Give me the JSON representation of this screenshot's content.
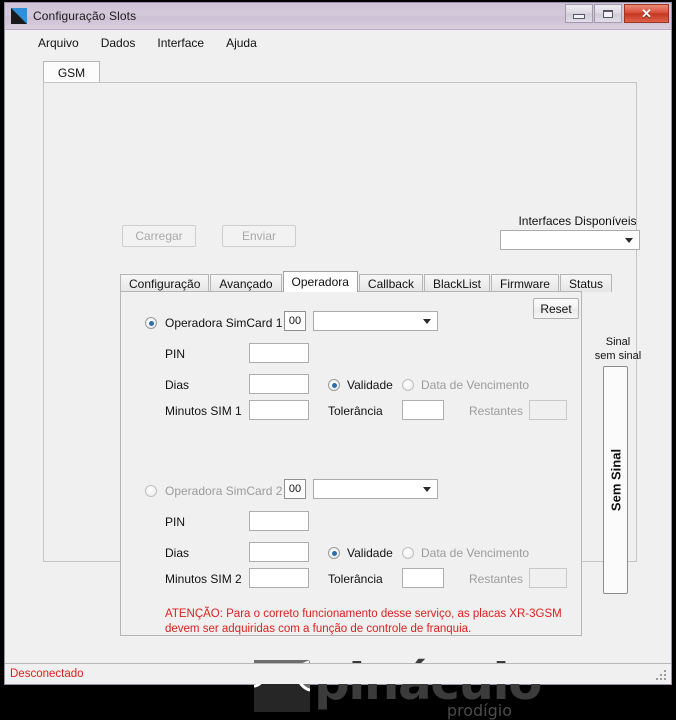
{
  "window": {
    "title": "Configuração Slots",
    "icon": "app-icon",
    "controls": {
      "minimize": "_",
      "maximize": "□",
      "close": "✕"
    }
  },
  "menu": {
    "items": [
      {
        "label": "Arquivo"
      },
      {
        "label": "Dados"
      },
      {
        "label": "Interface"
      },
      {
        "label": "Ajuda"
      }
    ]
  },
  "outer_tab": {
    "label": "GSM"
  },
  "toolbar": {
    "carregar_label": "Carregar",
    "enviar_label": "Enviar"
  },
  "interfaces": {
    "label": "Interfaces Disponíveis",
    "value": "",
    "placeholder": ""
  },
  "inner_tabs": [
    {
      "label": "Configuração",
      "active": false
    },
    {
      "label": "Avançado",
      "active": false
    },
    {
      "label": "Operadora",
      "active": true
    },
    {
      "label": "Callback",
      "active": false
    },
    {
      "label": "BlackList",
      "active": false
    },
    {
      "label": "Firmware",
      "active": false
    },
    {
      "label": "Status",
      "active": false
    }
  ],
  "reset_button": {
    "label": "Reset"
  },
  "simcard1": {
    "radio_label": "Operadora SimCard 1",
    "radio_selected": true,
    "code_value": "00",
    "operator_value": "",
    "pin_label": "PIN",
    "pin_value": "",
    "dias_label": "Dias",
    "dias_value": "",
    "minutos_label": "Minutos SIM 1",
    "minutos_value": "",
    "validade_label": "Validade",
    "validade_selected": true,
    "vencimento_label": "Data de Vencimento",
    "vencimento_selected": false,
    "tolerancia_label": "Tolerância",
    "tolerancia_value": "",
    "restantes_label": "Restantes",
    "restantes_value": ""
  },
  "simcard2": {
    "radio_label": "Operadora SimCard 2",
    "radio_selected": false,
    "code_value": "00",
    "operator_value": "",
    "pin_label": "PIN",
    "pin_value": "",
    "dias_label": "Dias",
    "dias_value": "",
    "minutos_label": "Minutos SIM 2",
    "minutos_value": "",
    "validade_label": "Validade",
    "validade_selected": true,
    "vencimento_label": "Data de Vencimento",
    "vencimento_selected": false,
    "tolerancia_label": "Tolerância",
    "tolerancia_value": "",
    "restantes_label": "Restantes",
    "restantes_value": ""
  },
  "warning": {
    "line1": "ATENÇÃO: Para o correto funcionamento desse serviço, as placas XR-3GSM",
    "line2": "devem ser adquiridas com a função de controle de franquia.",
    "color": "#e02020"
  },
  "signal": {
    "title_line1": "Sinal",
    "title_line2": "sem sinal",
    "bar_text": "Sem Sinal",
    "level": 0
  },
  "logo": {
    "name": "Pináculo",
    "wordmark": "pináculo",
    "subtitle": "prodígio"
  },
  "statusbar": {
    "text": "Desconectado",
    "color": "#e02020"
  }
}
